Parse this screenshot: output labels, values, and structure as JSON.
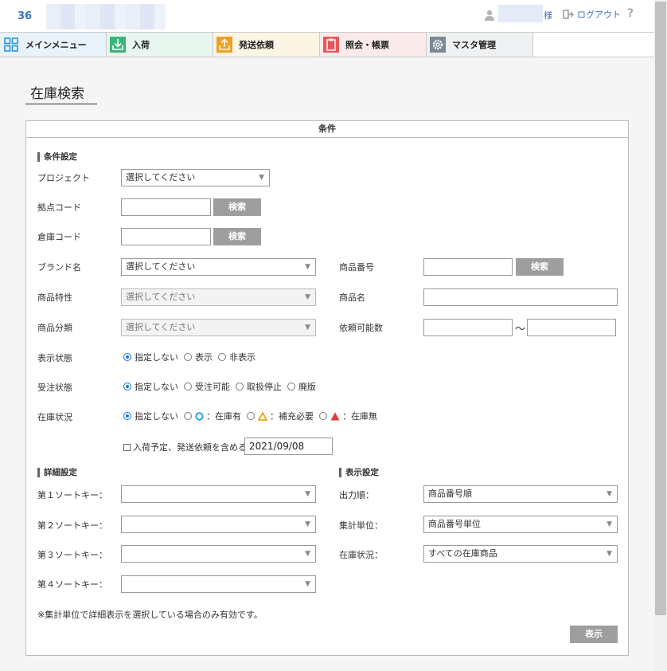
{
  "header": {
    "company_code": "36",
    "honorific": "様",
    "logout_label": "ログアウト",
    "help_label": "?"
  },
  "nav": [
    {
      "label": "メインメニュー"
    },
    {
      "label": "入荷"
    },
    {
      "label": "発送依頼"
    },
    {
      "label": "照会・帳票"
    },
    {
      "label": "マスタ管理"
    }
  ],
  "page": {
    "title": "在庫検索"
  },
  "panel": {
    "title": "条件"
  },
  "conditions": {
    "section_label": "条件設定",
    "project_label": "プロジェクト",
    "project_value": "選択してください",
    "base_code_label": "拠点コード",
    "base_code_value": "",
    "warehouse_code_label": "倉庫コード",
    "warehouse_code_value": "",
    "search_label": "検索",
    "brand_label": "ブランド名",
    "brand_value": "選択してください",
    "product_no_label": "商品番号",
    "product_no_value": "",
    "feature_label": "商品特性",
    "feature_value": "選択してください",
    "product_name_label": "商品名",
    "product_name_value": "",
    "category_label": "商品分類",
    "category_value": "選択してください",
    "request_qty_label": "依頼可能数",
    "request_qty_from": "",
    "request_qty_to": "",
    "range_sep": "～",
    "display_state": {
      "label": "表示状態",
      "options": [
        "指定しない",
        "表示",
        "非表示"
      ]
    },
    "order_state": {
      "label": "受注状態",
      "options": [
        "指定しない",
        "受注可能",
        "取扱停止",
        "廃版"
      ]
    },
    "stock_state": {
      "label": "在庫状況",
      "opt0": "指定しない",
      "opt1": "：在庫有",
      "opt2": "：補充必要",
      "opt3": "：在庫無",
      "circle_color": "#29a3e0",
      "warn_color": "#f0a020",
      "none_color": "#e53935"
    },
    "include_label": "入荷予定、発送依頼を含める",
    "include_date": "2021/09/08"
  },
  "detail": {
    "section_label": "詳細設定",
    "sort1_label": "第１ソートキー：",
    "sort2_label": "第２ソートキー：",
    "sort3_label": "第３ソートキー：",
    "sort4_label": "第４ソートキー：",
    "sort1_value": "",
    "sort2_value": "",
    "sort3_value": "",
    "sort4_value": "",
    "note": "※集計単位で詳細表示を選択している場合のみ有効です。"
  },
  "display": {
    "section_label": "表示設定",
    "order_label": "出力順：",
    "order_value": "商品番号順",
    "unit_label": "集計単位：",
    "unit_value": "商品番号単位",
    "stock_label": "在庫状況：",
    "stock_value": "すべての在庫商品"
  },
  "show_button": "表示",
  "colors": {
    "link_blue": "#3a6fc2",
    "radio_blue": "#1a73e8"
  }
}
